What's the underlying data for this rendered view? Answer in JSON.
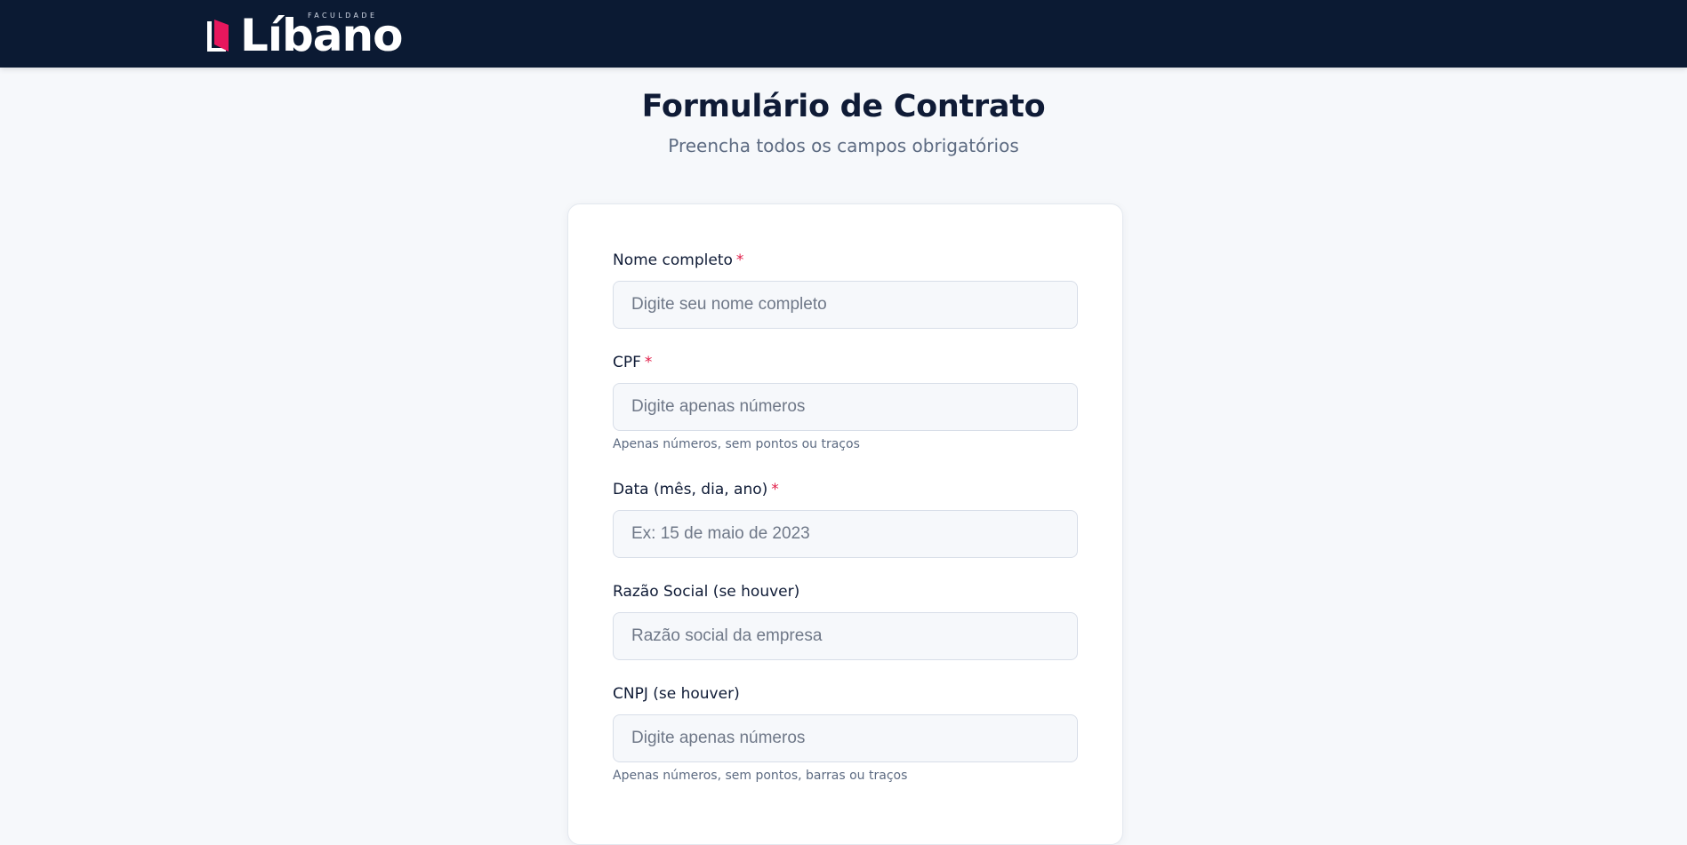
{
  "brand": {
    "kicker": "FACULDADE",
    "name": "Líbano",
    "primary_color": "#0b1a33",
    "accent_color": "#e8175d"
  },
  "page": {
    "title": "Formulário de Contrato",
    "subtitle": "Preencha todos os campos obrigatórios"
  },
  "form": {
    "required_marker": "*",
    "fields": [
      {
        "label": "Nome completo",
        "required": true,
        "value": "",
        "placeholder": "Digite seu nome completo",
        "hint": ""
      },
      {
        "label": "CPF",
        "required": true,
        "value": "",
        "placeholder": "Digite apenas números",
        "hint": "Apenas números, sem pontos ou traços"
      },
      {
        "label": "Data (mês, dia, ano)",
        "required": true,
        "value": "",
        "placeholder": "Ex: 15 de maio de 2023",
        "hint": ""
      },
      {
        "label": "Razão Social (se houver)",
        "required": false,
        "value": "",
        "placeholder": "Razão social da empresa",
        "hint": ""
      },
      {
        "label": "CNPJ (se houver)",
        "required": false,
        "value": "",
        "placeholder": "Digite apenas números",
        "hint": "Apenas números, sem pontos, barras ou traços"
      }
    ]
  }
}
